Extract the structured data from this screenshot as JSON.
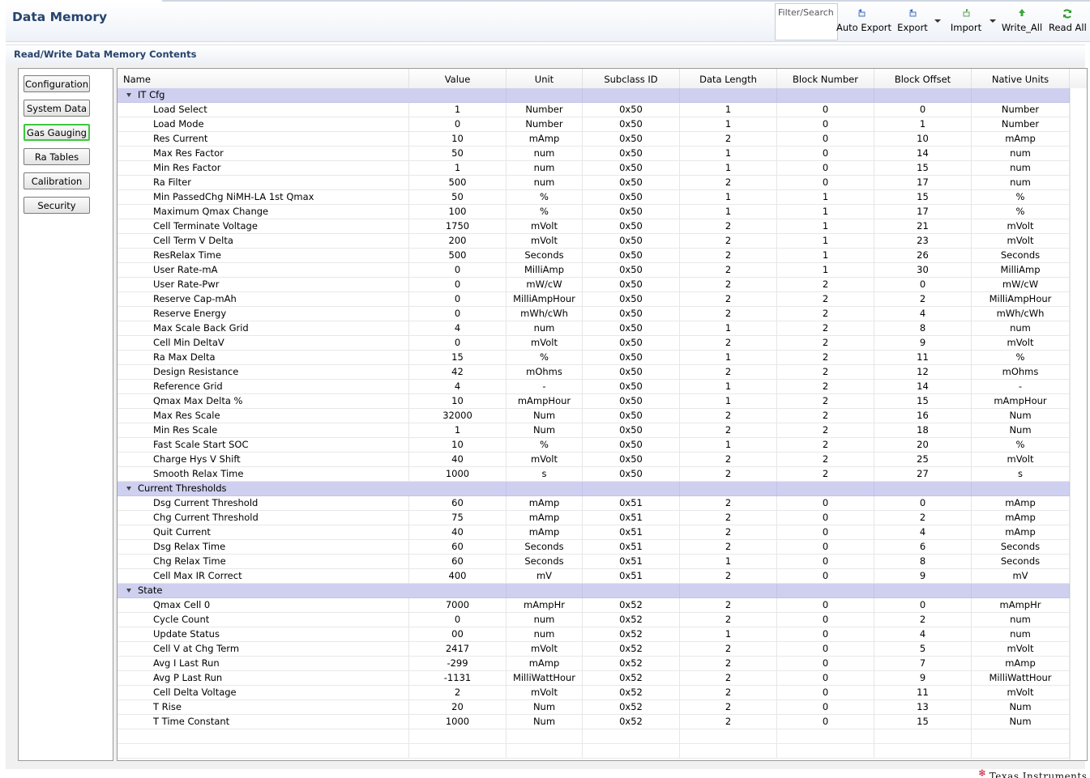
{
  "header": {
    "title": "Data Memory",
    "filter_label": "Filter/Search",
    "tools": [
      {
        "icon": "auto-export-icon",
        "label": "Auto Export"
      },
      {
        "icon": "export-icon",
        "label": "Export"
      },
      {
        "icon": "import-icon",
        "label": "Import"
      },
      {
        "icon": "write-all-icon",
        "label": "Write_All"
      },
      {
        "icon": "read-all-icon",
        "label": "Read All"
      }
    ]
  },
  "section_title": "Read/Write Data Memory Contents",
  "nav": [
    "Configuration",
    "System Data",
    "Gas Gauging",
    "Ra Tables",
    "Calibration",
    "Security"
  ],
  "active_nav": "Gas Gauging",
  "columns": [
    "Name",
    "Value",
    "Unit",
    "Subclass ID",
    "Data Length",
    "Block Number",
    "Block Offset",
    "Native Units"
  ],
  "groups": [
    {
      "name": "IT Cfg",
      "rows": [
        [
          "Load Select",
          "1",
          "Number",
          "0x50",
          "1",
          "0",
          "0",
          "Number"
        ],
        [
          "Load Mode",
          "0",
          "Number",
          "0x50",
          "1",
          "0",
          "1",
          "Number"
        ],
        [
          "Res Current",
          "10",
          "mAmp",
          "0x50",
          "2",
          "0",
          "10",
          "mAmp"
        ],
        [
          "Max Res Factor",
          "50",
          "num",
          "0x50",
          "1",
          "0",
          "14",
          "num"
        ],
        [
          "Min Res Factor",
          "1",
          "num",
          "0x50",
          "1",
          "0",
          "15",
          "num"
        ],
        [
          "Ra Filter",
          "500",
          "num",
          "0x50",
          "2",
          "0",
          "17",
          "num"
        ],
        [
          "Min PassedChg NiMH-LA 1st Qmax",
          "50",
          "%",
          "0x50",
          "1",
          "1",
          "15",
          "%"
        ],
        [
          "Maximum Qmax Change",
          "100",
          "%",
          "0x50",
          "1",
          "1",
          "17",
          "%"
        ],
        [
          "Cell Terminate Voltage",
          "1750",
          "mVolt",
          "0x50",
          "2",
          "1",
          "21",
          "mVolt"
        ],
        [
          "Cell Term V Delta",
          "200",
          "mVolt",
          "0x50",
          "2",
          "1",
          "23",
          "mVolt"
        ],
        [
          "ResRelax Time",
          "500",
          "Seconds",
          "0x50",
          "2",
          "1",
          "26",
          "Seconds"
        ],
        [
          "User Rate-mA",
          "0",
          "MilliAmp",
          "0x50",
          "2",
          "1",
          "30",
          "MilliAmp"
        ],
        [
          "User Rate-Pwr",
          "0",
          "mW/cW",
          "0x50",
          "2",
          "2",
          "0",
          "mW/cW"
        ],
        [
          "Reserve Cap-mAh",
          "0",
          "MilliAmpHour",
          "0x50",
          "2",
          "2",
          "2",
          "MilliAmpHour"
        ],
        [
          "Reserve Energy",
          "0",
          "mWh/cWh",
          "0x50",
          "2",
          "2",
          "4",
          "mWh/cWh"
        ],
        [
          "Max Scale Back Grid",
          "4",
          "num",
          "0x50",
          "1",
          "2",
          "8",
          "num"
        ],
        [
          "Cell Min DeltaV",
          "0",
          "mVolt",
          "0x50",
          "2",
          "2",
          "9",
          "mVolt"
        ],
        [
          "Ra Max Delta",
          "15",
          "%",
          "0x50",
          "1",
          "2",
          "11",
          "%"
        ],
        [
          "Design Resistance",
          "42",
          "mOhms",
          "0x50",
          "2",
          "2",
          "12",
          "mOhms"
        ],
        [
          "Reference Grid",
          "4",
          "-",
          "0x50",
          "1",
          "2",
          "14",
          "-"
        ],
        [
          "Qmax Max Delta %",
          "10",
          "mAmpHour",
          "0x50",
          "1",
          "2",
          "15",
          "mAmpHour"
        ],
        [
          "Max Res Scale",
          "32000",
          "Num",
          "0x50",
          "2",
          "2",
          "16",
          "Num"
        ],
        [
          "Min Res Scale",
          "1",
          "Num",
          "0x50",
          "2",
          "2",
          "18",
          "Num"
        ],
        [
          "Fast Scale Start SOC",
          "10",
          "%",
          "0x50",
          "1",
          "2",
          "20",
          "%"
        ],
        [
          "Charge Hys V Shift",
          "40",
          "mVolt",
          "0x50",
          "2",
          "2",
          "25",
          "mVolt"
        ],
        [
          "Smooth Relax Time",
          "1000",
          "s",
          "0x50",
          "2",
          "2",
          "27",
          "s"
        ]
      ]
    },
    {
      "name": "Current Thresholds",
      "rows": [
        [
          "Dsg Current Threshold",
          "60",
          "mAmp",
          "0x51",
          "2",
          "0",
          "0",
          "mAmp"
        ],
        [
          "Chg Current Threshold",
          "75",
          "mAmp",
          "0x51",
          "2",
          "0",
          "2",
          "mAmp"
        ],
        [
          "Quit Current",
          "40",
          "mAmp",
          "0x51",
          "2",
          "0",
          "4",
          "mAmp"
        ],
        [
          "Dsg Relax Time",
          "60",
          "Seconds",
          "0x51",
          "2",
          "0",
          "6",
          "Seconds"
        ],
        [
          "Chg Relax Time",
          "60",
          "Seconds",
          "0x51",
          "1",
          "0",
          "8",
          "Seconds"
        ],
        [
          "Cell Max IR Correct",
          "400",
          "mV",
          "0x51",
          "2",
          "0",
          "9",
          "mV"
        ]
      ]
    },
    {
      "name": "State",
      "rows": [
        [
          "Qmax Cell 0",
          "7000",
          "mAmpHr",
          "0x52",
          "2",
          "0",
          "0",
          "mAmpHr"
        ],
        [
          "Cycle Count",
          "0",
          "num",
          "0x52",
          "2",
          "0",
          "2",
          "num"
        ],
        [
          "Update Status",
          "00",
          "num",
          "0x52",
          "1",
          "0",
          "4",
          "num"
        ],
        [
          "Cell V at Chg Term",
          "2417",
          "mVolt",
          "0x52",
          "2",
          "0",
          "5",
          "mVolt"
        ],
        [
          "Avg I Last Run",
          "-299",
          "mAmp",
          "0x52",
          "2",
          "0",
          "7",
          "mAmp"
        ],
        [
          "Avg P Last Run",
          "-1131",
          "MilliWattHour",
          "0x52",
          "2",
          "0",
          "9",
          "MilliWattHour"
        ],
        [
          "Cell Delta Voltage",
          "2",
          "mVolt",
          "0x52",
          "2",
          "0",
          "11",
          "mVolt"
        ],
        [
          "T Rise",
          "20",
          "Num",
          "0x52",
          "2",
          "0",
          "13",
          "Num"
        ],
        [
          "T Time Constant",
          "1000",
          "Num",
          "0x52",
          "2",
          "0",
          "15",
          "Num"
        ]
      ]
    }
  ],
  "footer_logo": "Texas Instruments",
  "colors": {
    "title": "#27446d",
    "group_row": "#cfd0f0",
    "active_nav_border": "#3ec63e",
    "logo_red": "#c8102e"
  }
}
